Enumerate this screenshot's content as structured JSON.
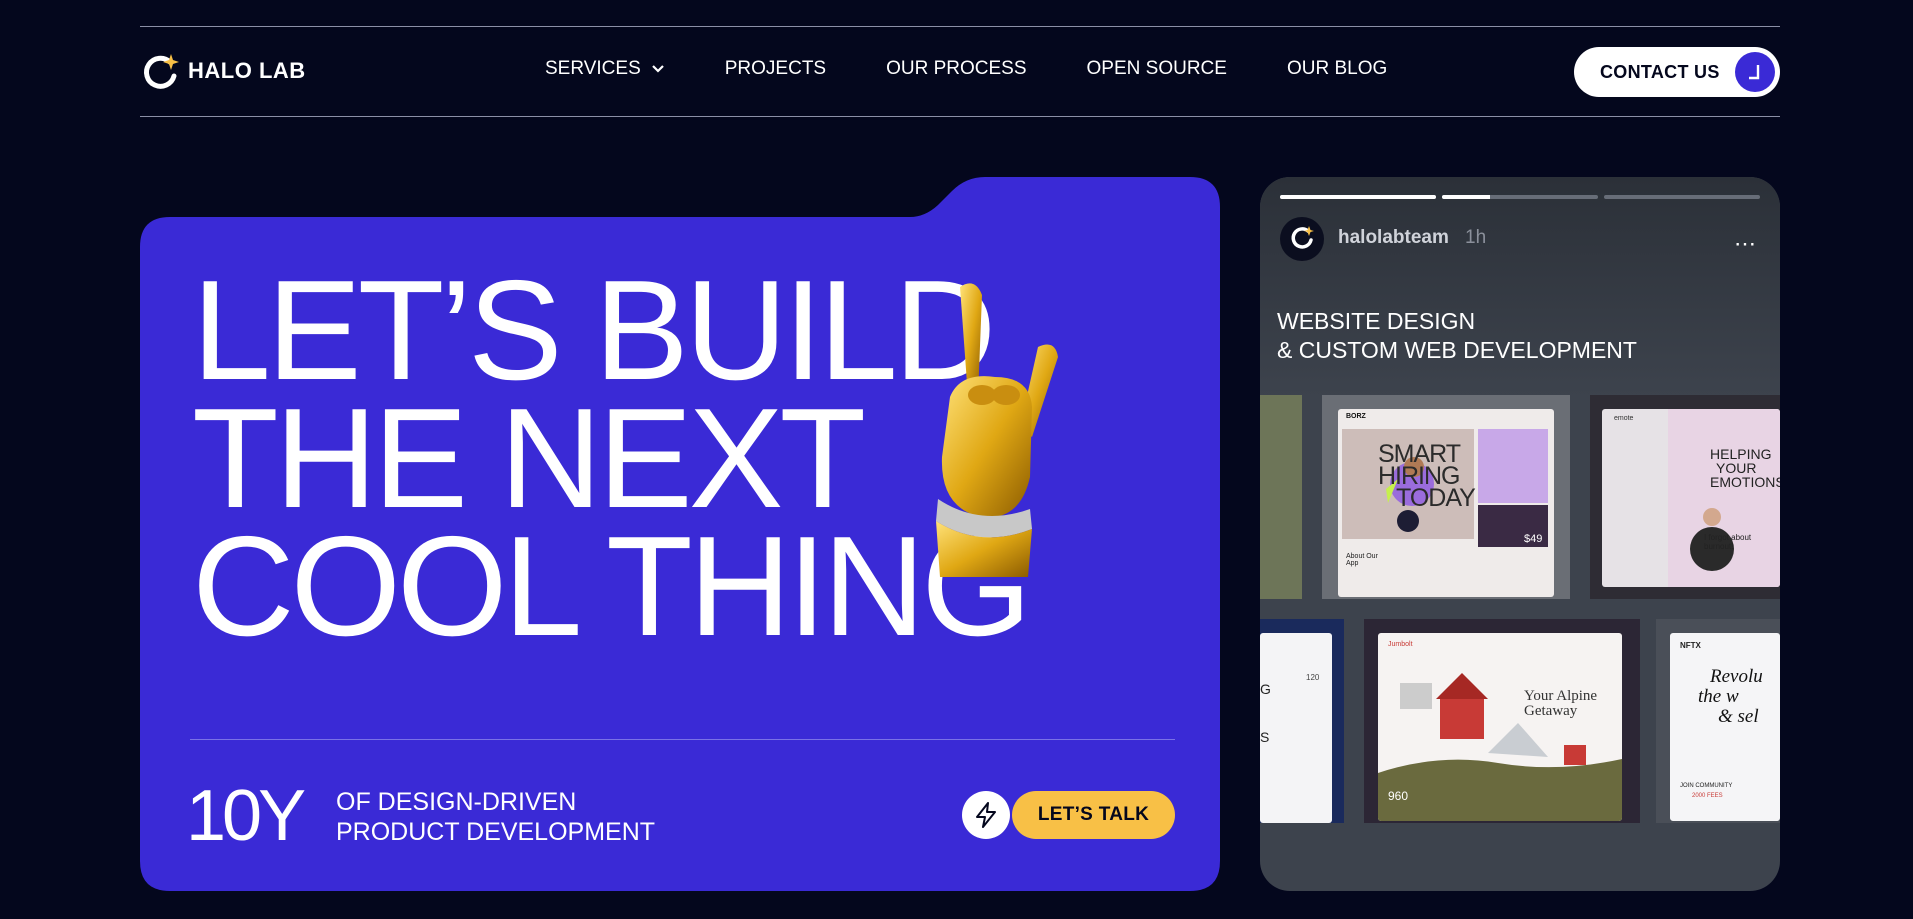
{
  "header": {
    "logo_text": "HALO LAB",
    "nav": [
      {
        "label": "SERVICES"
      },
      {
        "label": "PROJECTS"
      },
      {
        "label": "OUR PROCESS"
      },
      {
        "label": "OPEN SOURCE"
      },
      {
        "label": "OUR BLOG"
      }
    ],
    "contact_label": "CONTACT US"
  },
  "hero": {
    "headline": [
      "LET’S BUILD",
      "THE NEXT",
      "COOL THING"
    ],
    "years": "10Y",
    "tagline": [
      "OF DESIGN-DRIVEN",
      "PRODUCT DEVELOPMENT"
    ],
    "cta_label": "LET’S TALK"
  },
  "story": {
    "username": "halolabteam",
    "time": "1h",
    "more_icon": "⋯",
    "title": [
      "WEBSITE DESIGN",
      "& CUSTOM WEB DEVELOPMENT"
    ],
    "progress": [
      1.0,
      0.31,
      0.0
    ],
    "shots": {
      "smart_hiring": {
        "brand": "BORZ",
        "headline": [
          "SMART",
          "HIRING",
          "TODAY"
        ],
        "about": "About Our App",
        "price": "$49"
      },
      "emotions": {
        "brand": "emote",
        "headline": [
          "HELPING",
          "YOUR",
          "EMOTIONS"
        ],
        "quote": "I forgot about burnout!"
      },
      "alpine": {
        "brand": "Jumbolt",
        "headline": "Your Alpine Getaway",
        "stat": "960"
      },
      "nftx": {
        "brand": "NFTX",
        "headline": [
          "Revolu",
          "the w",
          "& sel"
        ],
        "cta": "JOIN COMMUNITY",
        "price": "2000 FEES"
      },
      "partial_left": {
        "letters": [
          "G",
          "S"
        ],
        "badge": "120"
      }
    }
  },
  "colors": {
    "background": "#04071d",
    "hero": "#3a2ad6",
    "cta": "#f8c046",
    "story": "#3d434d"
  }
}
